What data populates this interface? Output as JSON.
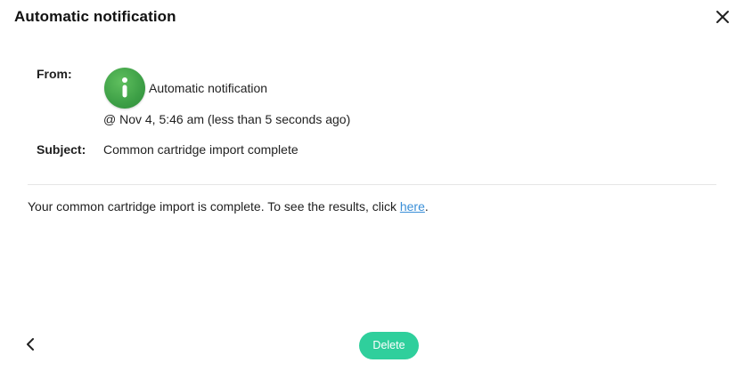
{
  "dialog": {
    "title": "Automatic notification"
  },
  "message": {
    "from_label": "From:",
    "sender_name": "Automatic notification",
    "timestamp": "@ Nov 4, 5:46 am (less than 5 seconds ago)",
    "subject_label": "Subject:",
    "subject": "Common cartridge import complete",
    "body_prefix": "Your common cartridge import is complete. To see the results, click ",
    "body_link": "here",
    "body_suffix": "."
  },
  "footer": {
    "delete_label": "Delete"
  },
  "icons": {
    "close": "close-icon",
    "info": "info-icon",
    "back": "chevron-left-icon"
  },
  "colors": {
    "accent": "#2fcf9c",
    "avatar": "#3d9f46",
    "link": "#3a8fd8"
  }
}
